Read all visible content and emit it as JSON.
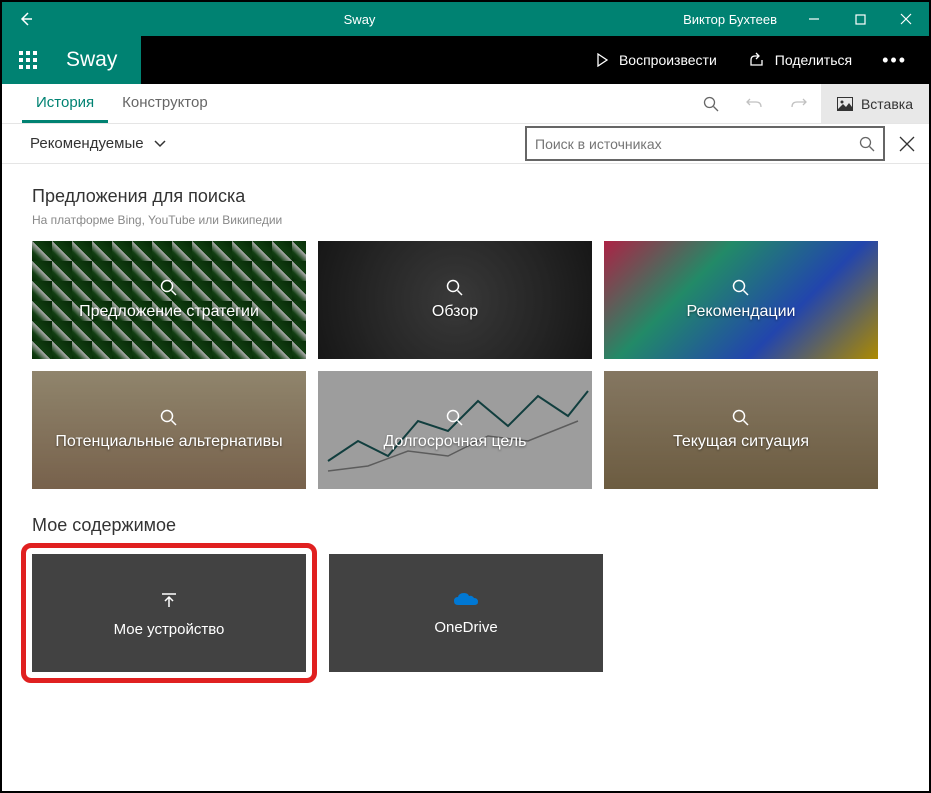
{
  "titlebar": {
    "title": "Sway",
    "user": "Виктор Бухтеев"
  },
  "topbar": {
    "app": "Sway",
    "play": "Воспроизвести",
    "share": "Поделиться"
  },
  "tabs": {
    "story": "История",
    "design": "Конструктор",
    "insert": "Вставка"
  },
  "filter": {
    "recommended": "Рекомендуемые"
  },
  "search": {
    "placeholder": "Поиск в источниках"
  },
  "suggestions": {
    "heading": "Предложения для поиска",
    "subheading": "На платформе Bing, YouTube или Википедии",
    "tiles": [
      {
        "label": "Предложение стратегии"
      },
      {
        "label": "Обзор"
      },
      {
        "label": "Рекомендации"
      },
      {
        "label": "Потенциальные альтернативы"
      },
      {
        "label": "Долгосрочная цель"
      },
      {
        "label": "Текущая ситуация"
      }
    ]
  },
  "mycontent": {
    "heading": "Мое содержимое",
    "device": "Мое устройство",
    "onedrive": "OneDrive"
  }
}
